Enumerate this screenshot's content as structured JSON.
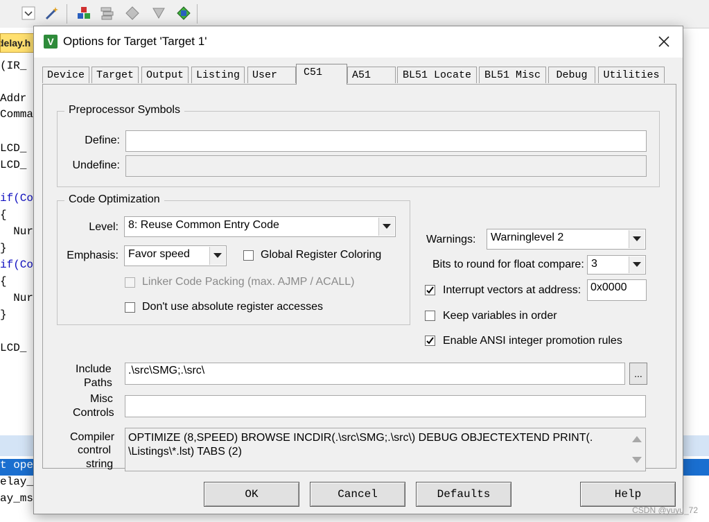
{
  "editor": {
    "file_tab": "delay.h",
    "code_lines": [
      "(IR_",
      "",
      "Addr",
      "Comma",
      "",
      "LCD_",
      "LCD_",
      "",
      "if(Co",
      "{",
      "  Nur",
      "}",
      "if(Co",
      "{",
      "  Nur",
      "}",
      "",
      "LCD_"
    ]
  },
  "output": {
    "lines": [
      "t ope",
      "elay_",
      "ay_ms"
    ]
  },
  "dialog": {
    "title": "Options for Target 'Target 1'",
    "tabs": [
      {
        "label": "Device"
      },
      {
        "label": "Target"
      },
      {
        "label": "Output"
      },
      {
        "label": "Listing"
      },
      {
        "label": "User"
      },
      {
        "label": "C51"
      },
      {
        "label": "A51"
      },
      {
        "label": "BL51 Locate"
      },
      {
        "label": "BL51 Misc"
      },
      {
        "label": "Debug"
      },
      {
        "label": "Utilities"
      }
    ],
    "active_tab": "C51",
    "preprocessor": {
      "title": "Preprocessor Symbols",
      "define_label": "Define:",
      "define_value": "",
      "undefine_label": "Undefine:",
      "undefine_value": ""
    },
    "code_optimization": {
      "title": "Code Optimization",
      "level_label": "Level:",
      "level_value": "8: Reuse Common Entry Code",
      "emphasis_label": "Emphasis:",
      "emphasis_value": "Favor speed",
      "global_register_label": "Global Register Coloring",
      "global_register_checked": false,
      "linker_packing_label": "Linker Code Packing (max. AJMP / ACALL)",
      "linker_packing_checked": false,
      "no_abs_reg_label": "Don't use absolute register accesses",
      "no_abs_reg_checked": false
    },
    "right_options": {
      "warnings_label": "Warnings:",
      "warnings_value": "Warninglevel 2",
      "bits_label": "Bits to round for float compare:",
      "bits_value": "3",
      "interrupt_label": "Interrupt vectors at address:",
      "interrupt_checked": true,
      "interrupt_value": "0x0000",
      "keep_vars_label": "Keep variables in order",
      "keep_vars_checked": false,
      "ansi_label": "Enable ANSI integer promotion rules",
      "ansi_checked": true
    },
    "include_paths": {
      "label_1": "Include",
      "label_2": "Paths",
      "value": ".\\src\\SMG;.\\src\\",
      "browse_label": "..."
    },
    "misc_controls": {
      "label_1": "Misc",
      "label_2": "Controls",
      "value": ""
    },
    "compiler_string": {
      "label_1": "Compiler",
      "label_2": "control",
      "label_3": "string",
      "value_line_1": "OPTIMIZE (8,SPEED) BROWSE INCDIR(.\\src\\SMG;.\\src\\) DEBUG OBJECTEXTEND PRINT(.",
      "value_line_2": "\\Listings\\*.lst) TABS (2)"
    },
    "buttons": {
      "ok": "OK",
      "cancel": "Cancel",
      "defaults": "Defaults",
      "help": "Help"
    }
  },
  "watermark": "CSDN @yuyu_72",
  "colors": {
    "dialog_bg": "#f0f0f0",
    "selection_blue": "#1a6fd0",
    "keyword_blue": "#1010c0",
    "file_tab_yellow": "#ffe070"
  }
}
